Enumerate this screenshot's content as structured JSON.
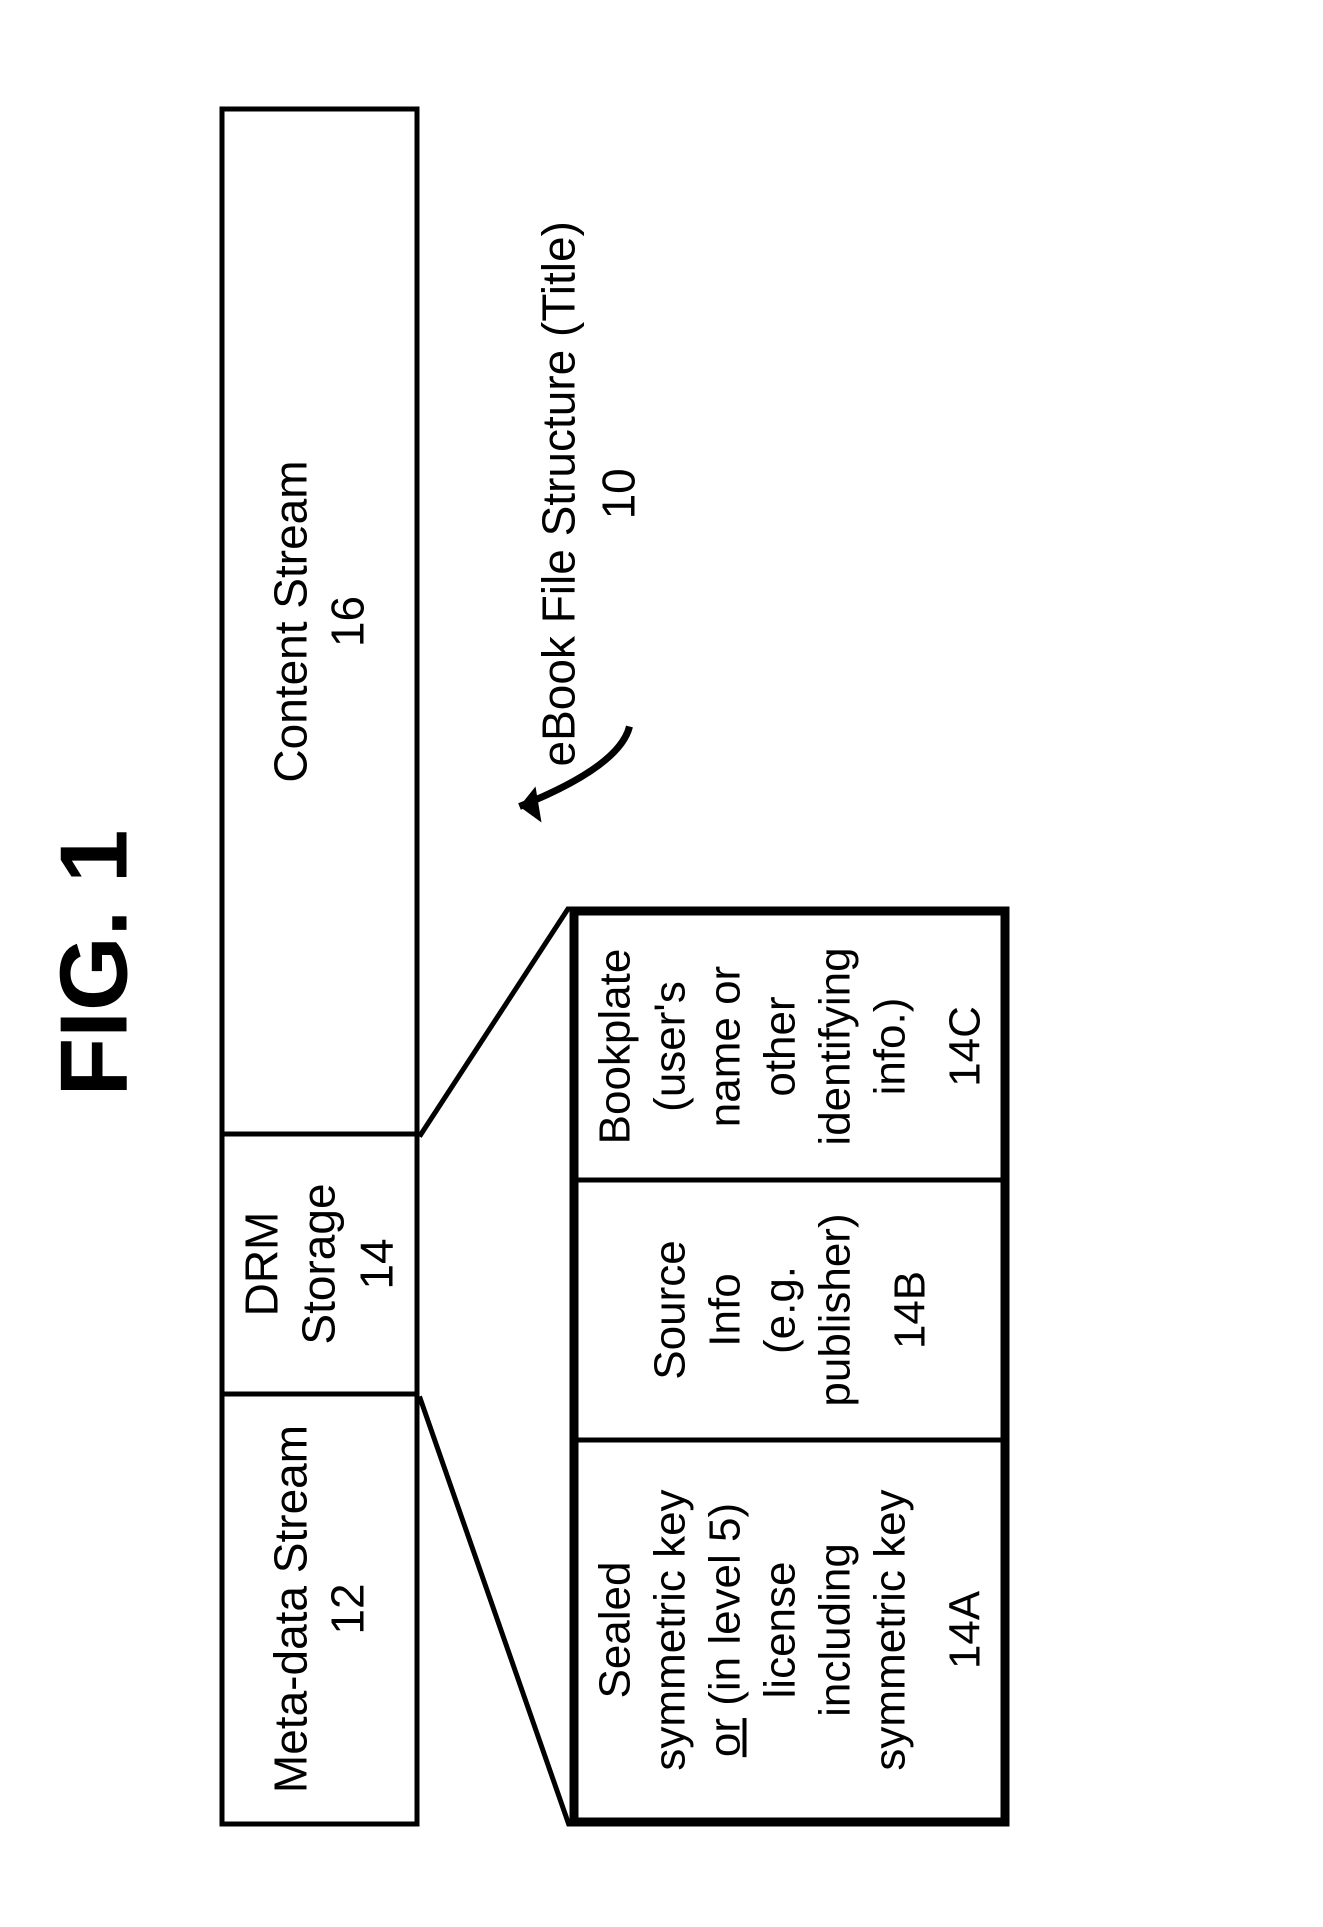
{
  "figure_label": "FIG. 1",
  "top_row": {
    "meta": {
      "label": "Meta-data Stream",
      "ref": "12"
    },
    "drm": {
      "label": "DRM Storage",
      "ref": "14"
    },
    "content": {
      "label": "Content Stream",
      "ref": "16"
    }
  },
  "drm_detail": {
    "a": {
      "line1": "Sealed",
      "line2": "symmetric key",
      "line3_prefix": "or",
      "line3_suffix": "  (in level 5)",
      "line4": "license",
      "line5": "including",
      "line6": "symmetric key",
      "ref": "14A"
    },
    "b": {
      "line1": "Source",
      "line2": "Info",
      "line3": "(e.g.",
      "line4": "publisher)",
      "ref": "14B"
    },
    "c": {
      "line1": "Bookplate",
      "line2": "(user's",
      "line3": "name or",
      "line4": "other",
      "line5": "identifying",
      "line6": "info.)",
      "ref": "14C"
    }
  },
  "overall": {
    "label": "eBook File Structure (Title)",
    "ref": "10"
  }
}
